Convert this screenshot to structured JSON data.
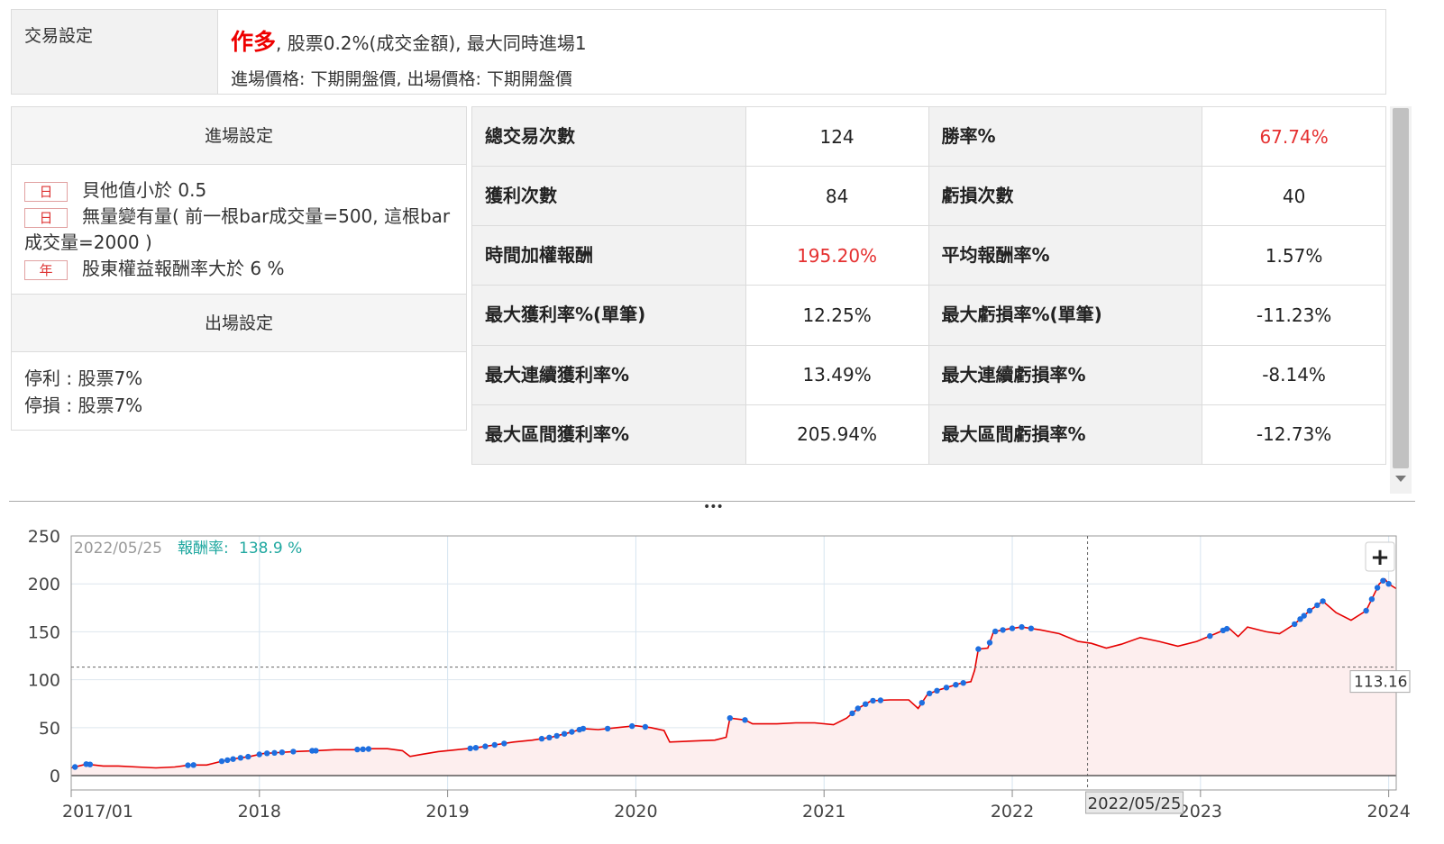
{
  "trade_settings": {
    "label": "交易設定",
    "direction": "作多",
    "line1_rest": ", 股票0.2%(成交金額), 最大同時進場1",
    "line2": "進場價格: 下期開盤價, 出場價格: 下期開盤價"
  },
  "entry": {
    "title": "進場設定",
    "conditions": [
      {
        "tag": "日",
        "text": "貝他值小於 0.5"
      },
      {
        "tag": "日",
        "text": "無量變有量( 前一根bar成交量=500, 這根bar成交量=2000 )"
      },
      {
        "tag": "年",
        "text": "股東權益報酬率大於 6 %"
      }
    ]
  },
  "exit": {
    "title": "出場設定",
    "lines": [
      "停利 : 股票7%",
      "停損 : 股票7%"
    ]
  },
  "stats": [
    [
      {
        "k": "總交易次數",
        "v": "124"
      },
      {
        "k": "勝率%",
        "v": "67.74%",
        "red": true
      }
    ],
    [
      {
        "k": "獲利次數",
        "v": "84"
      },
      {
        "k": "虧損次數",
        "v": "40"
      }
    ],
    [
      {
        "k": "時間加權報酬",
        "v": "195.20%",
        "red": true
      },
      {
        "k": "平均報酬率%",
        "v": "1.57%"
      }
    ],
    [
      {
        "k": "最大獲利率%(單筆)",
        "v": "12.25%"
      },
      {
        "k": "最大虧損率%(單筆)",
        "v": "-11.23%"
      }
    ],
    [
      {
        "k": "最大連續獲利率%",
        "v": "13.49%"
      },
      {
        "k": "最大連續虧損率%",
        "v": "-8.14%"
      }
    ],
    [
      {
        "k": "最大區間獲利率%",
        "v": "205.94%"
      },
      {
        "k": "最大區間虧損率%",
        "v": "-12.73%"
      }
    ]
  ],
  "chart": {
    "tooltip_date": "2022/05/25",
    "tooltip_label": "報酬率:",
    "tooltip_value": "138.9 %",
    "crosshair_date": "2022/05/25",
    "crosshair_value": "113.16",
    "zoom_button": "+",
    "colors": {
      "line": "#e60000",
      "area": "#fdeeee",
      "marker": "#1e6fe0",
      "tooltip": "#20a8a0"
    }
  },
  "chart_data": {
    "type": "area",
    "title": "",
    "xlabel": "",
    "ylabel": "",
    "xlim": [
      2017.0,
      2024.04
    ],
    "ylim": [
      -15,
      250
    ],
    "yticks": [
      0,
      50,
      100,
      150,
      200,
      250
    ],
    "xticks": [
      {
        "label": "2017/01",
        "x": 2017.0
      },
      {
        "label": "2018",
        "x": 2018.0
      },
      {
        "label": "2019",
        "x": 2019.0
      },
      {
        "label": "2020",
        "x": 2020.0
      },
      {
        "label": "2021",
        "x": 2021.0
      },
      {
        "label": "2022",
        "x": 2022.0
      },
      {
        "label": "2023",
        "x": 2023.0
      },
      {
        "label": "2024",
        "x": 2024.0
      }
    ],
    "grid": true,
    "crosshair": {
      "x": 2022.4,
      "y": 113.16
    },
    "series": [
      {
        "values": [
          [
            2017.0,
            8
          ],
          [
            2017.08,
            12
          ],
          [
            2017.17,
            10
          ],
          [
            2017.25,
            10
          ],
          [
            2017.35,
            9
          ],
          [
            2017.45,
            8
          ],
          [
            2017.55,
            9
          ],
          [
            2017.63,
            11
          ],
          [
            2017.72,
            11
          ],
          [
            2017.8,
            15
          ],
          [
            2017.88,
            18
          ],
          [
            2017.95,
            20
          ],
          [
            2018.02,
            23
          ],
          [
            2018.1,
            24
          ],
          [
            2018.18,
            25
          ],
          [
            2018.3,
            26
          ],
          [
            2018.4,
            27
          ],
          [
            2018.5,
            27
          ],
          [
            2018.6,
            28
          ],
          [
            2018.68,
            28
          ],
          [
            2018.76,
            26
          ],
          [
            2018.8,
            20
          ],
          [
            2018.86,
            22
          ],
          [
            2018.95,
            25
          ],
          [
            2019.05,
            27
          ],
          [
            2019.15,
            29
          ],
          [
            2019.25,
            32
          ],
          [
            2019.35,
            35
          ],
          [
            2019.45,
            37
          ],
          [
            2019.55,
            40
          ],
          [
            2019.65,
            45
          ],
          [
            2019.72,
            49
          ],
          [
            2019.8,
            48
          ],
          [
            2019.9,
            50
          ],
          [
            2020.0,
            52
          ],
          [
            2020.08,
            50
          ],
          [
            2020.15,
            47
          ],
          [
            2020.18,
            35
          ],
          [
            2020.3,
            36
          ],
          [
            2020.42,
            37
          ],
          [
            2020.48,
            40
          ],
          [
            2020.5,
            60
          ],
          [
            2020.58,
            58
          ],
          [
            2020.62,
            54
          ],
          [
            2020.75,
            54
          ],
          [
            2020.85,
            55
          ],
          [
            2020.95,
            55
          ],
          [
            2021.05,
            53
          ],
          [
            2021.12,
            60
          ],
          [
            2021.18,
            70
          ],
          [
            2021.25,
            78
          ],
          [
            2021.35,
            79
          ],
          [
            2021.45,
            79
          ],
          [
            2021.5,
            70
          ],
          [
            2021.55,
            85
          ],
          [
            2021.62,
            90
          ],
          [
            2021.72,
            96
          ],
          [
            2021.78,
            98
          ],
          [
            2021.8,
            110
          ],
          [
            2021.82,
            132
          ],
          [
            2021.87,
            133
          ],
          [
            2021.9,
            150
          ],
          [
            2021.98,
            153
          ],
          [
            2022.05,
            155
          ],
          [
            2022.15,
            152
          ],
          [
            2022.25,
            148
          ],
          [
            2022.35,
            140
          ],
          [
            2022.42,
            138
          ],
          [
            2022.5,
            133
          ],
          [
            2022.58,
            137
          ],
          [
            2022.68,
            144
          ],
          [
            2022.78,
            140
          ],
          [
            2022.88,
            135
          ],
          [
            2022.98,
            140
          ],
          [
            2023.08,
            148
          ],
          [
            2023.15,
            154
          ],
          [
            2023.2,
            145
          ],
          [
            2023.25,
            155
          ],
          [
            2023.35,
            150
          ],
          [
            2023.42,
            148
          ],
          [
            2023.5,
            158
          ],
          [
            2023.58,
            172
          ],
          [
            2023.65,
            182
          ],
          [
            2023.72,
            170
          ],
          [
            2023.8,
            162
          ],
          [
            2023.88,
            172
          ],
          [
            2023.95,
            200
          ],
          [
            2023.98,
            205
          ],
          [
            2024.0,
            200
          ],
          [
            2024.04,
            195
          ]
        ]
      }
    ],
    "markers": [
      2017.02,
      2017.08,
      2017.1,
      2017.62,
      2017.65,
      2017.8,
      2017.83,
      2017.86,
      2017.9,
      2017.94,
      2018.0,
      2018.04,
      2018.08,
      2018.12,
      2018.18,
      2018.28,
      2018.3,
      2018.52,
      2018.55,
      2018.58,
      2019.12,
      2019.15,
      2019.2,
      2019.25,
      2019.3,
      2019.5,
      2019.54,
      2019.58,
      2019.62,
      2019.66,
      2019.7,
      2019.72,
      2019.85,
      2019.98,
      2020.05,
      2020.5,
      2020.58,
      2021.15,
      2021.18,
      2021.22,
      2021.26,
      2021.3,
      2021.52,
      2021.56,
      2021.6,
      2021.65,
      2021.7,
      2021.74,
      2021.82,
      2021.88,
      2021.91,
      2021.95,
      2022.0,
      2022.05,
      2022.1,
      2023.05,
      2023.12,
      2023.14,
      2023.5,
      2023.53,
      2023.55,
      2023.58,
      2023.62,
      2023.65,
      2023.88,
      2023.91,
      2023.94,
      2023.97,
      2024.0
    ]
  }
}
